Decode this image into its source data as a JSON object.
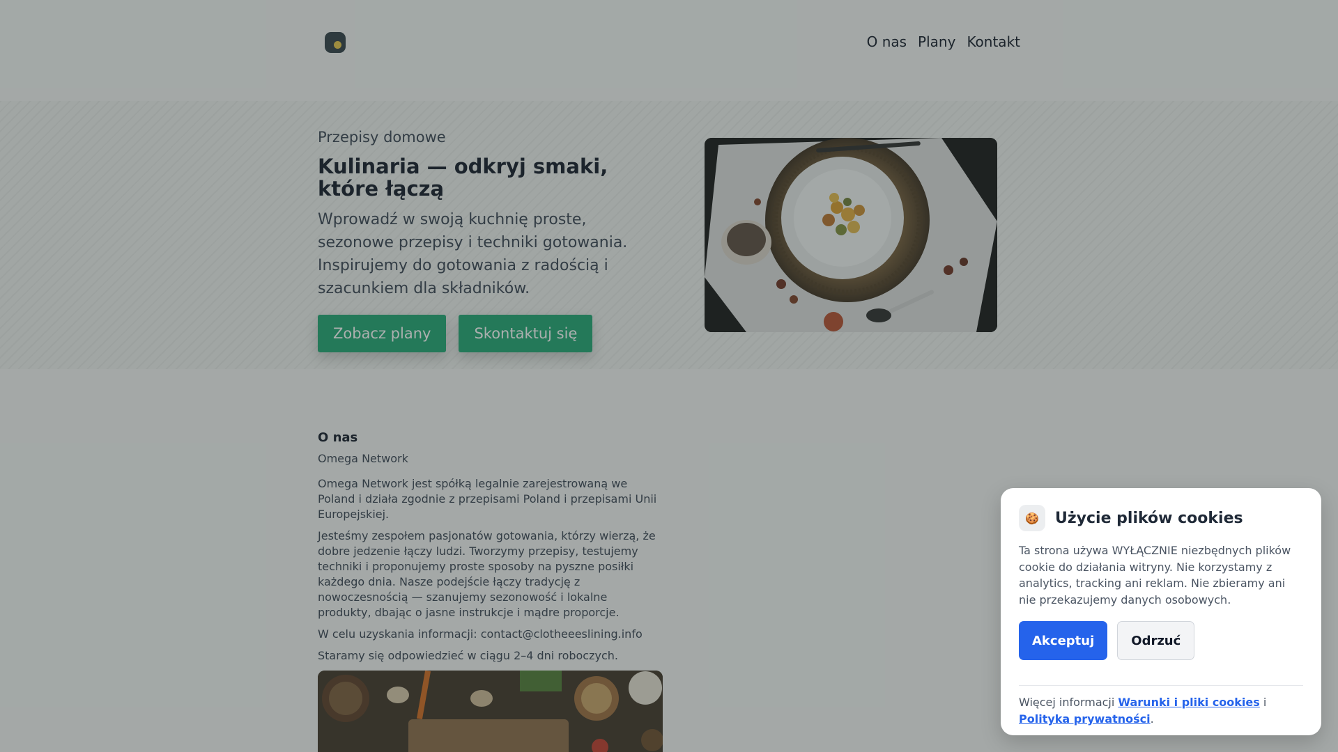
{
  "nav": {
    "items": [
      "O nas",
      "Plany",
      "Kontakt"
    ]
  },
  "hero": {
    "eyebrow": "Przepisy domowe",
    "title_line1": "Kulinaria — odkryj smaki,",
    "title_line2": "które łączą",
    "lead": "Wprowadź w swoją kuchnię proste, sezonowe przepisy i techniki gotowania. Inspirujemy do gotowania z radością i szacunkiem dla składników.",
    "primary_button": "Zobacz plany",
    "secondary_button": "Skontaktuj się"
  },
  "about": {
    "heading": "O nas",
    "company": "Omega Network",
    "paragraphs": [
      "Omega Network jest spółką legalnie zarejestrowaną we Poland i działa zgodnie z przepisami Poland i przepisami Unii Europejskiej.",
      "Jesteśmy zespołem pasjonatów gotowania, którzy wierzą, że dobre jedzenie łączy ludzi. Tworzymy przepisy, testujemy techniki i proponujemy proste sposoby na pyszne posiłki każdego dnia. Nasze podejście łączy tradycję z nowoczesnością — szanujemy sezonowość i lokalne produkty, dbając o jasne instrukcje i mądre proporcje.",
      "W celu uzyskania informacji: contact@clotheeeslining.info",
      "Staramy się odpowiedzieć w ciągu 2–4 dni roboczych."
    ]
  },
  "cookie": {
    "icon": "🍪",
    "title": "Użycie plików cookies",
    "text": "Ta strona używa WYŁĄCZNIE niezbędnych plików cookie do działania witryny. Nie korzystamy z analytics, tracking ani reklam. Nie zbieramy ani nie przekazujemy danych osobowych.",
    "accept": "Akceptuj",
    "reject": "Odrzuć",
    "more_prefix": "Więcej informacji",
    "link_terms": "Warunki i pliki cookies",
    "conjunction": "i",
    "link_privacy": "Polityka prywatności",
    "suffix": "."
  },
  "colors": {
    "accent_green": "#1ea672",
    "accent_blue": "#2563eb",
    "logo_dot": "#e8c547"
  }
}
